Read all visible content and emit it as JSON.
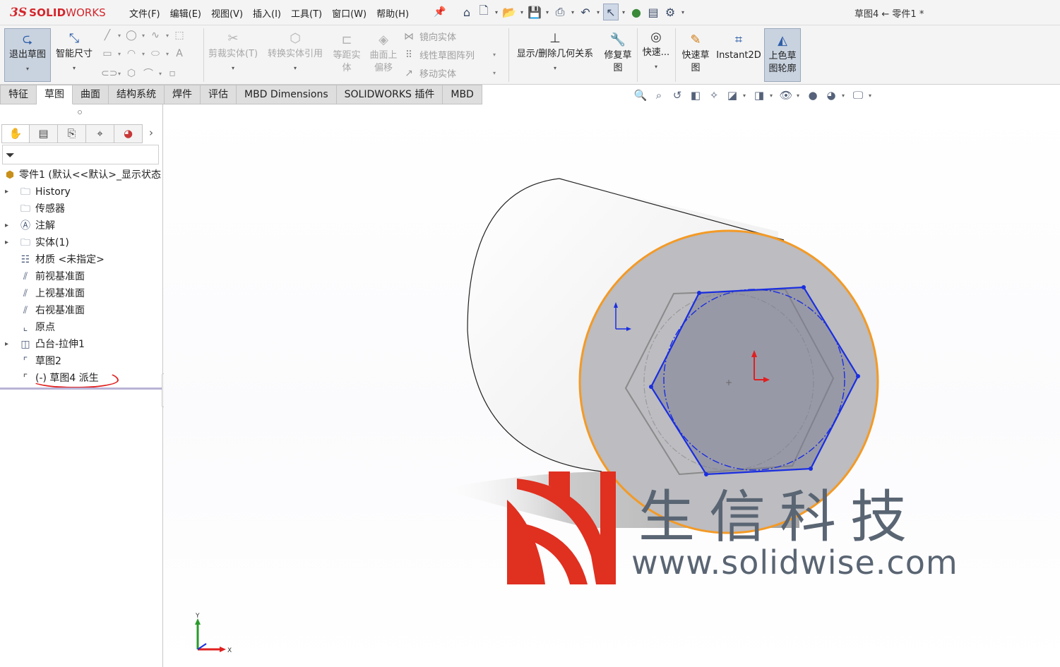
{
  "app": {
    "logo_prefix": "3S",
    "logo_solid": "SOLID",
    "logo_works": "WORKS",
    "doc_title": "草图4 ← 零件1 *"
  },
  "menu": [
    "文件(F)",
    "编辑(E)",
    "视图(V)",
    "插入(I)",
    "工具(T)",
    "窗口(W)",
    "帮助(H)"
  ],
  "quickbar_icons": [
    "home-icon",
    "new-document-icon",
    "open-icon",
    "save-icon",
    "print-icon",
    "undo-icon",
    "select-arrow-icon",
    "rebuild-icon",
    "file-properties-icon",
    "options-gear-icon"
  ],
  "commands": {
    "exit_sketch": "退出草图",
    "smart_dimension": "智能尺寸",
    "trim": "剪裁实体(T)",
    "convert": "转换实体引用",
    "offset": "等距实体",
    "offset_surface": "曲面上偏移",
    "mirror": "镜向实体",
    "linear_pattern": "线性草图阵列",
    "move": "移动实体",
    "display_relations": "显示/删除几何关系",
    "repair_sketch": "修复草图",
    "quick_snaps": "快速...",
    "rapid_sketch": "快速草图",
    "instant2d": "Instant2D",
    "shaded_contours": "上色草图轮廓"
  },
  "tabs": [
    "特征",
    "草图",
    "曲面",
    "结构系统",
    "焊件",
    "评估",
    "MBD Dimensions",
    "SOLIDWORKS 插件",
    "MBD"
  ],
  "active_tab": "草图",
  "panel_tabs": [
    "feature-manager-icon",
    "property-manager-icon",
    "configuration-manager-icon",
    "dimxpert-icon",
    "display-manager-icon"
  ],
  "tree": {
    "root": "零件1 (默认<<默认>_显示状态",
    "items": [
      {
        "label": "History",
        "icon": "history-folder-icon",
        "expandable": true
      },
      {
        "label": "传感器",
        "icon": "sensor-icon",
        "expandable": false
      },
      {
        "label": "注解",
        "icon": "annotation-icon",
        "expandable": true
      },
      {
        "label": "实体(1)",
        "icon": "solid-body-icon",
        "expandable": true
      },
      {
        "label": "材质 <未指定>",
        "icon": "material-icon",
        "expandable": false
      },
      {
        "label": "前视基准面",
        "icon": "plane-icon",
        "expandable": false
      },
      {
        "label": "上视基准面",
        "icon": "plane-icon",
        "expandable": false
      },
      {
        "label": "右视基准面",
        "icon": "plane-icon",
        "expandable": false
      },
      {
        "label": "原点",
        "icon": "origin-icon",
        "expandable": false
      },
      {
        "label": "凸台-拉伸1",
        "icon": "extrude-icon",
        "expandable": true
      },
      {
        "label": "草图2",
        "icon": "sketch-icon",
        "expandable": false
      },
      {
        "label": "(-) 草图4 派生",
        "icon": "derived-sketch-icon",
        "expandable": false
      }
    ]
  },
  "watermark": {
    "cn": "生信科技",
    "url": "www.solidwise.com"
  },
  "triad": {
    "x": "X",
    "y": "Y"
  },
  "colors": {
    "brand_red": "#d4252b",
    "edge_orange": "#f39a26",
    "sketch_blue": "#1a2ee0",
    "highlight_red": "#e02020"
  }
}
